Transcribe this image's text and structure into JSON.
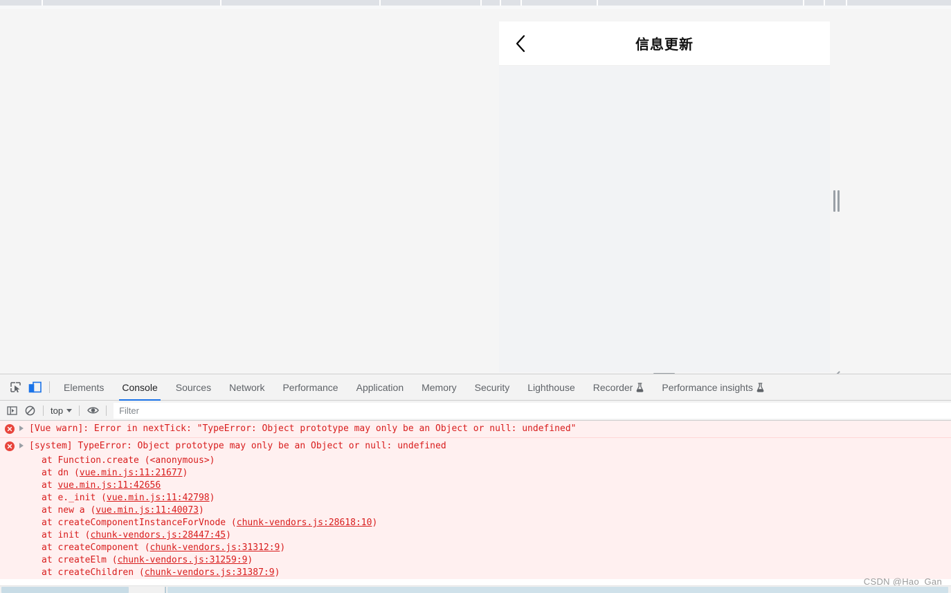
{
  "browser": {
    "tabstrip_separators_x": [
      60,
      318,
      548,
      694,
      722,
      752,
      862,
      1160,
      1190,
      1222
    ]
  },
  "device_emulation": {
    "page": {
      "back_icon": "chevron-left-icon",
      "title": "信息更新"
    },
    "handles": {
      "right": "resize-handle-right",
      "bottom": "resize-handle-bottom",
      "corner": "resize-handle-corner"
    }
  },
  "devtools": {
    "left_icons": [
      {
        "name": "inspect-element-icon",
        "active": false
      },
      {
        "name": "device-toolbar-icon",
        "active": true
      }
    ],
    "tabs": [
      {
        "label": "Elements",
        "active": false,
        "flask": false
      },
      {
        "label": "Console",
        "active": true,
        "flask": false
      },
      {
        "label": "Sources",
        "active": false,
        "flask": false
      },
      {
        "label": "Network",
        "active": false,
        "flask": false
      },
      {
        "label": "Performance",
        "active": false,
        "flask": false
      },
      {
        "label": "Application",
        "active": false,
        "flask": false
      },
      {
        "label": "Memory",
        "active": false,
        "flask": false
      },
      {
        "label": "Security",
        "active": false,
        "flask": false
      },
      {
        "label": "Lighthouse",
        "active": false,
        "flask": false
      },
      {
        "label": "Recorder",
        "active": false,
        "flask": true
      },
      {
        "label": "Performance insights",
        "active": false,
        "flask": true
      }
    ],
    "console_toolbar": {
      "sidebar_icon": "console-sidebar-icon",
      "clear_icon": "clear-console-icon",
      "context_label": "top",
      "eye_icon": "live-expression-eye-icon",
      "filter_placeholder": "Filter",
      "filter_value": ""
    },
    "messages": [
      {
        "level": "error",
        "icon": "error-circle-icon",
        "expandable": true,
        "text": "[Vue warn]: Error in nextTick: \"TypeError: Object prototype may only be an Object or null: undefined\""
      },
      {
        "level": "error",
        "icon": "error-circle-icon",
        "expandable": true,
        "text": "[system] TypeError: Object prototype may only be an Object or null: undefined"
      }
    ],
    "stack_trace": [
      {
        "prefix": "at Function.create (",
        "link": "",
        "plain": "<anonymous>",
        "suffix": ")"
      },
      {
        "prefix": "at dn (",
        "link": "vue.min.js:11:21677",
        "plain": "",
        "suffix": ")"
      },
      {
        "prefix": "at ",
        "link": "vue.min.js:11:42656",
        "plain": "",
        "suffix": ""
      },
      {
        "prefix": "at e._init (",
        "link": "vue.min.js:11:42798",
        "plain": "",
        "suffix": ")"
      },
      {
        "prefix": "at new a (",
        "link": "vue.min.js:11:40073",
        "plain": "",
        "suffix": ")"
      },
      {
        "prefix": "at createComponentInstanceForVnode (",
        "link": "chunk-vendors.js:28618:10",
        "plain": "",
        "suffix": ")"
      },
      {
        "prefix": "at init (",
        "link": "chunk-vendors.js:28447:45",
        "plain": "",
        "suffix": ")"
      },
      {
        "prefix": "at createComponent (",
        "link": "chunk-vendors.js:31312:9",
        "plain": "",
        "suffix": ")"
      },
      {
        "prefix": "at createElm (",
        "link": "chunk-vendors.js:31259:9",
        "plain": "",
        "suffix": ")"
      },
      {
        "prefix": "at createChildren (",
        "link": "chunk-vendors.js:31387:9",
        "plain": "",
        "suffix": ")"
      }
    ]
  },
  "watermark": "CSDN @Hao_Gan",
  "colors": {
    "accent_blue": "#1a73e8",
    "error_red": "#d81c1c",
    "error_bg": "#fff0f0",
    "device_bg": "#f2f3f5",
    "toolbar_bg": "#f3f3f3"
  }
}
